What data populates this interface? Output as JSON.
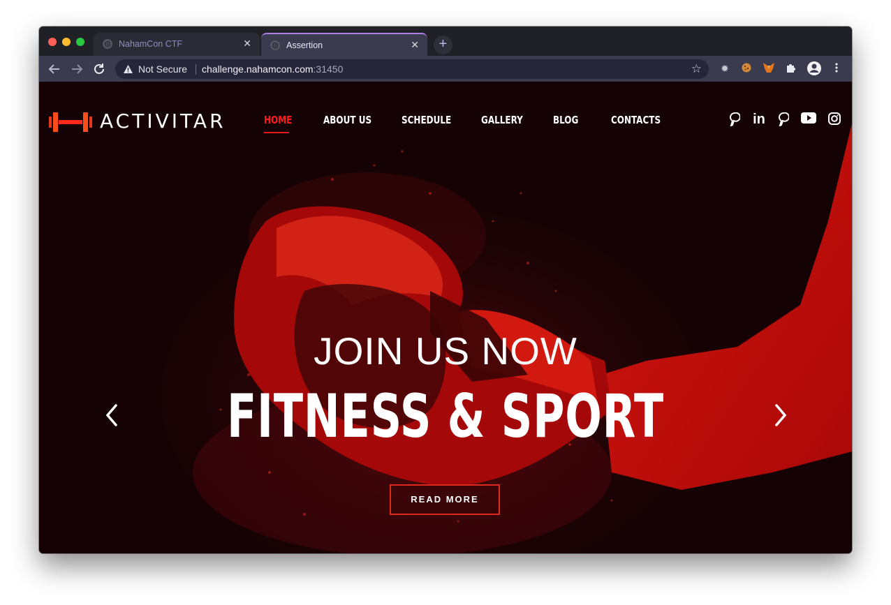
{
  "browser": {
    "tabs": [
      {
        "title": "NahamCon CTF",
        "active": false
      },
      {
        "title": "Assertion",
        "active": true
      }
    ],
    "new_tab_label": "+",
    "security_label": "Not Secure",
    "url_host": "challenge.nahamcon.com",
    "url_port": ":31450",
    "icons": [
      "back-icon",
      "forward-icon",
      "reload-icon",
      "bookmark-star-icon",
      "settings-gear-icon",
      "cookie-icon",
      "metamask-fox-icon",
      "extensions-puzzle-icon",
      "profile-icon",
      "kebab-menu-icon"
    ],
    "tab_accent_color": "#b07fe6"
  },
  "site": {
    "brand": "ACTIVITAR",
    "nav": [
      "HOME",
      "ABOUT US",
      "SCHEDULE",
      "GALLERY",
      "BLOG",
      "CONTACTS"
    ],
    "nav_active": "HOME",
    "social_icons": [
      "pinterest-icon",
      "linkedin-icon",
      "pinterest-icon",
      "youtube-icon",
      "instagram-icon"
    ],
    "hero": {
      "subtitle": "JOIN US NOW",
      "title": "FITNESS & SPORT",
      "cta": "READ MORE"
    },
    "accent_color": "#e81b1b"
  }
}
